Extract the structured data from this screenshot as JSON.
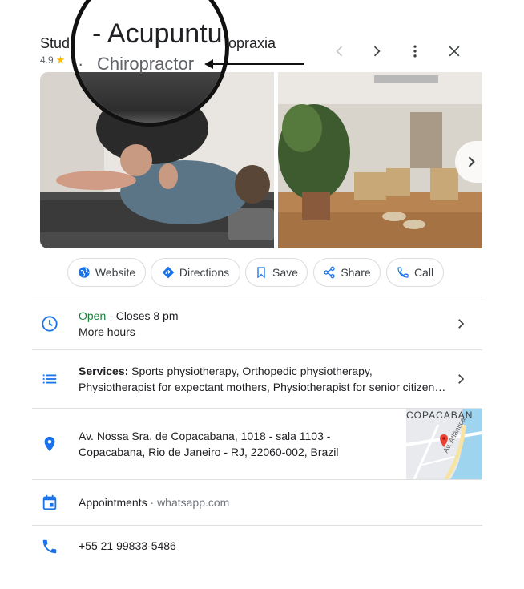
{
  "header": {
    "title_left": "Studi",
    "title_right": "iropraxia",
    "rating": "4.9",
    "magnifier_title": "- Acupuntu",
    "magnifier_dot": "·",
    "magnifier_subtitle": "Chiropractor"
  },
  "header_buttons": [
    {
      "name": "prev",
      "icon": "chevron-left-icon"
    },
    {
      "name": "next",
      "icon": "chevron-right-icon"
    },
    {
      "name": "more",
      "icon": "more-vert-icon"
    },
    {
      "name": "close",
      "icon": "close-icon"
    }
  ],
  "actions": {
    "website": "Website",
    "directions": "Directions",
    "save": "Save",
    "share": "Share",
    "call": "Call"
  },
  "hours": {
    "status": "Open",
    "separator": " · ",
    "closes": "Closes 8 pm",
    "more": "More hours"
  },
  "services": {
    "label": "Services:",
    "line1": " Sports physiotherapy, Orthopedic physiotherapy,",
    "line2": "Physiotherapist for expectant mothers, Physiotherapist for senior citizen…"
  },
  "address": {
    "line1": "Av. Nossa Sra. de Copacabana, 1018 - sala 1103 -",
    "line2": "Copacabana, Rio de Janeiro - RJ, 22060-002, Brazil",
    "map_label": "COPACABAN",
    "map_street": "Av. Atlântica"
  },
  "appointments": {
    "label": "Appointments",
    "separator": " · ",
    "link": "whatsapp.com"
  },
  "phone": "+55 21 99833-5486",
  "colors": {
    "accent_blue": "#1a73e8",
    "open_green": "#188038",
    "star_yellow": "#fbbc04",
    "pin_red": "#ea4335"
  }
}
